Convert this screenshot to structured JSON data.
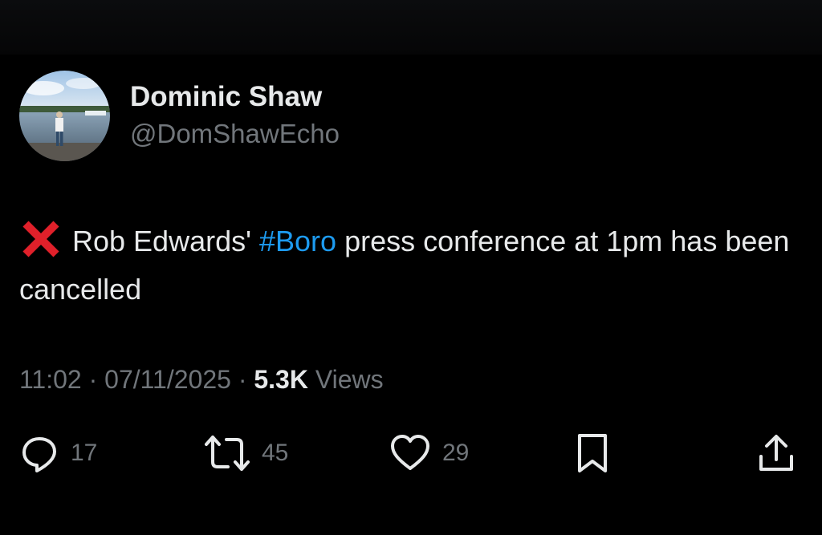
{
  "author": {
    "display_name": "Dominic Shaw",
    "handle": "@DomShawEcho",
    "avatar_icon": "avatar-photo-lake"
  },
  "tweet": {
    "emoji_icon": "cross-mark-icon",
    "text_before": "Rob Edwards' ",
    "hashtag": "#Boro",
    "text_after": " press conference at 1pm has been cancelled"
  },
  "meta": {
    "time": "11:02",
    "separator": " · ",
    "date": "07/11/2025",
    "views_count": "5.3K",
    "views_label": "Views"
  },
  "actions": {
    "replies": "17",
    "reposts": "45",
    "likes": "29"
  },
  "colors": {
    "background": "#000000",
    "text": "#e7e9ea",
    "secondary": "#71767b",
    "link": "#1d9bf0",
    "cross": "#e0202a"
  }
}
